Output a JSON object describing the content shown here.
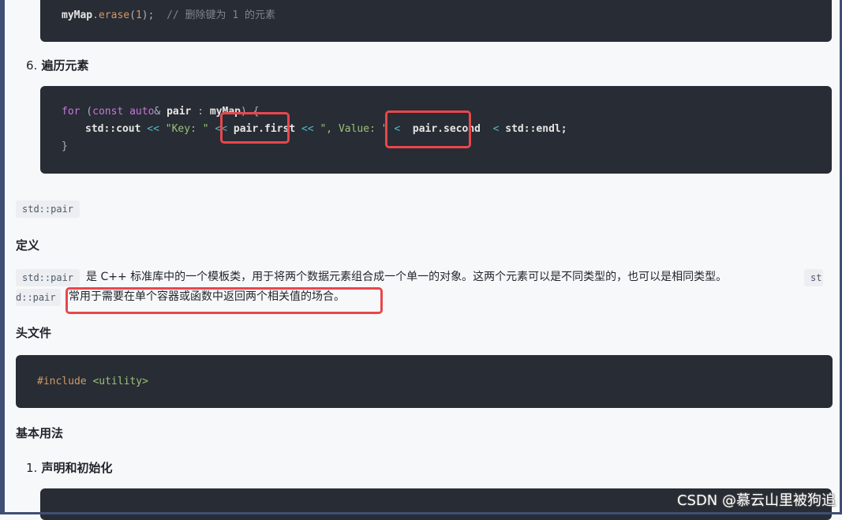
{
  "block1": {
    "prefix": "myMap",
    "method": "erase",
    "arg": "1",
    "comment": "// 删除键为 1 的元素"
  },
  "list_item_6": {
    "number": "6.",
    "title": "遍历元素"
  },
  "block2": {
    "kw_for": "for",
    "paren_open": " (",
    "kw_const": "const",
    "kw_auto": "auto",
    "amp": "&",
    "var": "pair",
    "colon": " : ",
    "map": "myMap",
    "tail1": ") {",
    "line2_cout": "std::cout",
    "op1": " << ",
    "s1": "\"Key: \"",
    "op2": " <<",
    "pf": "pair.first",
    "op3": "<< ",
    "s2": "\", Value: \"",
    "op4": " <",
    "ps": "pair.second",
    "op5": "< ",
    "endl": "std::endl;",
    "close": "}"
  },
  "inline_std_pair": "std::pair",
  "h_definition": "定义",
  "para": {
    "code1": "std::pair",
    "text1": "是 C++ 标准库中的一个模板类，用于将两个数据元素组合成一个单一的对象。这两个元素可以是不同类型的，也可以是相同类型。",
    "code2_a": "st",
    "code2_b": "d::pair",
    "text2": "常用于需要在单个容器或函数中返回两个相关值的场合。"
  },
  "h_header": "头文件",
  "block3": {
    "include": "#include",
    "lib": "<utility>"
  },
  "h_basic": "基本用法",
  "list_item_1": {
    "number": "1.",
    "title": "声明和初始化"
  },
  "watermark": "CSDN @慕云山里被狗追"
}
